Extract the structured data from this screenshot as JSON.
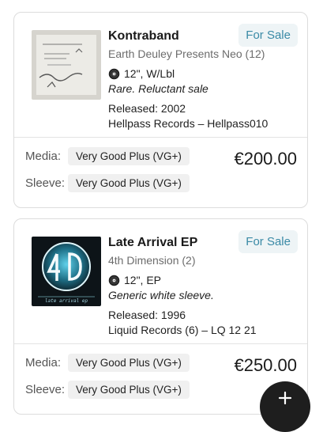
{
  "listings": [
    {
      "title": "Kontraband",
      "artist": "Earth Deuley Presents Neo (12)",
      "format": "12\", W/Lbl",
      "note": "Rare. Reluctant sale",
      "released": "Released: 2002",
      "label": "Hellpass Records – Hellpass010",
      "status": "For Sale",
      "media_label": "Media:",
      "media_condition": "Very Good Plus (VG+)",
      "sleeve_label": "Sleeve:",
      "sleeve_condition": "Very Good Plus (VG+)",
      "price": "€200.00"
    },
    {
      "title": "Late Arrival EP",
      "artist": "4th Dimension (2)",
      "format": "12\", EP",
      "note": "Generic white sleeve.",
      "released": "Released: 1996",
      "label": "Liquid Records (6) – LQ 12 21",
      "status": "For Sale",
      "media_label": "Media:",
      "media_condition": "Very Good Plus (VG+)",
      "sleeve_label": "Sleeve:",
      "sleeve_condition": "Very Good Plus (VG+)",
      "price": "€250.00"
    }
  ],
  "colors": {
    "accent": "#3a8aa6",
    "badge_bg": "#eef4f6",
    "fab_bg": "#1e1e1e"
  },
  "icons": {
    "format": "vinyl-record-icon",
    "fab": "plus-icon"
  }
}
